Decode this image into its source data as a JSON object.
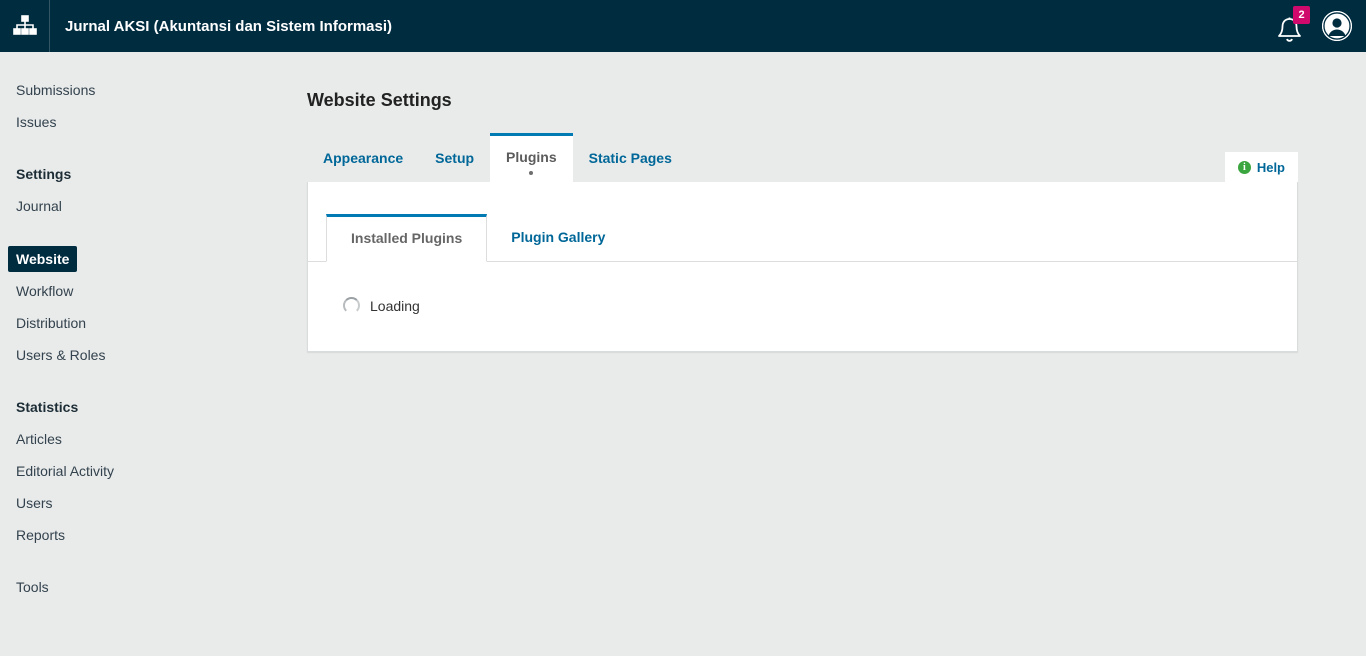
{
  "header": {
    "title": "Jurnal AKSI (Akuntansi dan Sistem Informasi)",
    "notification_count": "2"
  },
  "sidebar": {
    "items": [
      {
        "label": "Submissions"
      },
      {
        "label": "Issues"
      },
      {
        "label": "Settings"
      },
      {
        "label": "Journal"
      },
      {
        "label": "Website"
      },
      {
        "label": "Workflow"
      },
      {
        "label": "Distribution"
      },
      {
        "label": "Users & Roles"
      },
      {
        "label": "Statistics"
      },
      {
        "label": "Articles"
      },
      {
        "label": "Editorial Activity"
      },
      {
        "label": "Users"
      },
      {
        "label": "Reports"
      },
      {
        "label": "Tools"
      }
    ],
    "active_item": "Website"
  },
  "main": {
    "page_title": "Website Settings",
    "tabs": [
      {
        "label": "Appearance"
      },
      {
        "label": "Setup"
      },
      {
        "label": "Plugins",
        "active": true
      },
      {
        "label": "Static Pages"
      }
    ],
    "help": {
      "label": "Help",
      "icon_glyph": "i"
    },
    "plugin_tabs": [
      {
        "label": "Installed Plugins",
        "active": true
      },
      {
        "label": "Plugin Gallery"
      }
    ],
    "loading_label": "Loading"
  },
  "colors": {
    "topbar": "#002c40",
    "accent_blue": "#006798",
    "active_tab_border": "#007ab2",
    "badge_pink": "#d00a6c",
    "help_green": "#3ba53f",
    "page_background": "#e9ebeb"
  }
}
